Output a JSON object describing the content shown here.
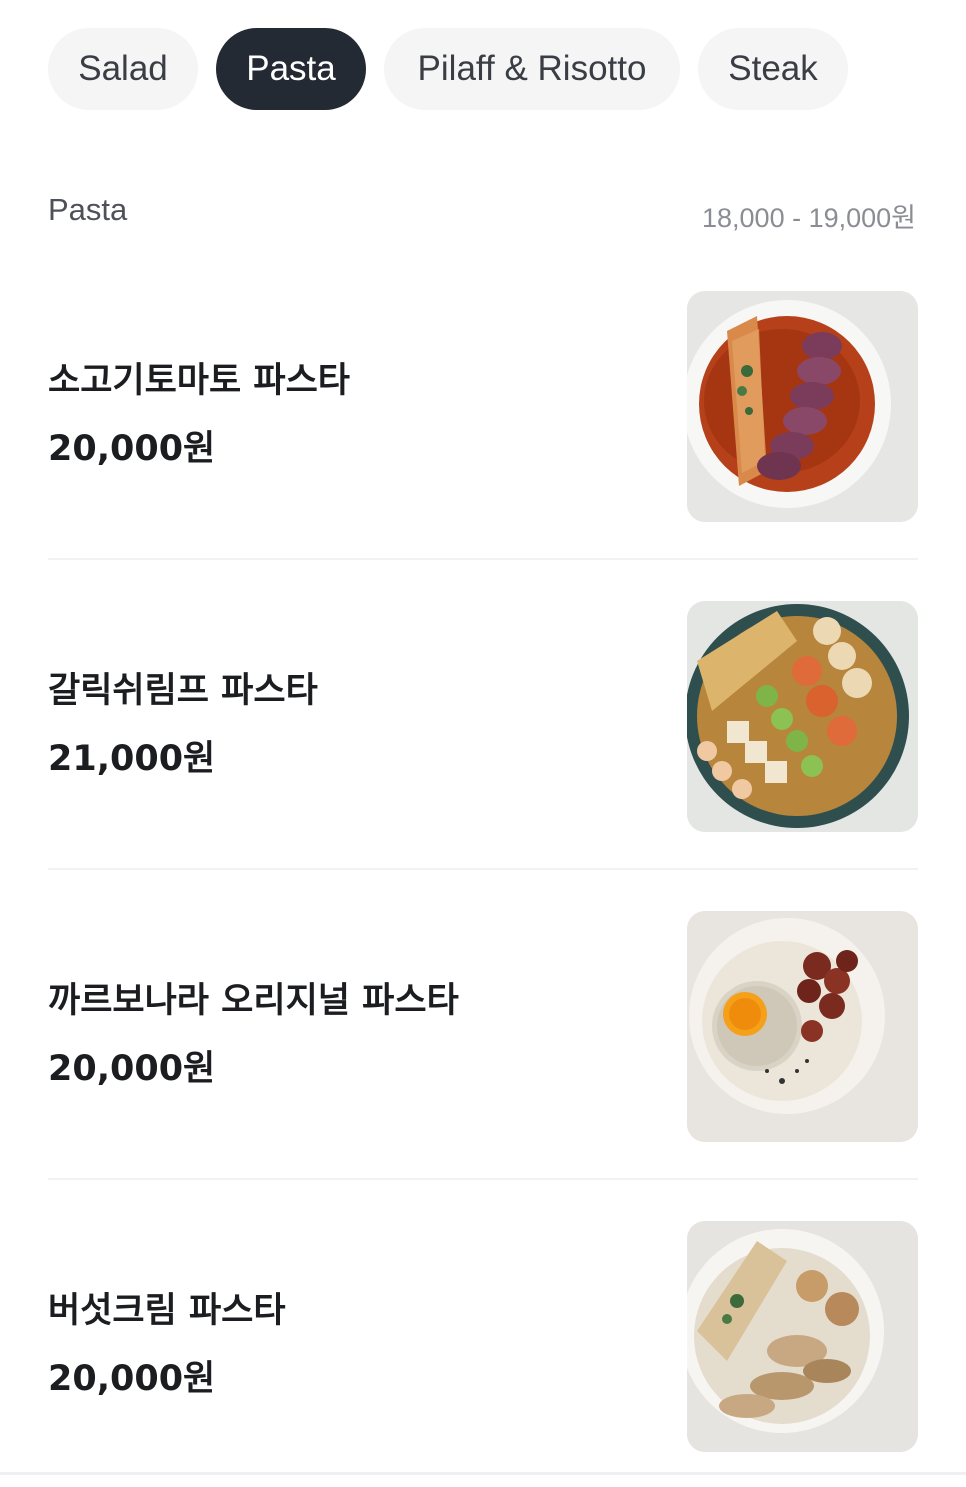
{
  "tabs": [
    {
      "label": "Salad",
      "active": false
    },
    {
      "label": "Pasta",
      "active": true
    },
    {
      "label": "Pilaff & Risotto",
      "active": false
    },
    {
      "label": "Steak",
      "active": false
    }
  ],
  "section": {
    "title": "Pasta",
    "price_range": "18,000 - 19,000원"
  },
  "items": [
    {
      "name": "소고기토마토 파스타",
      "price": "20,000원",
      "image": "beef-tomato-pasta-photo"
    },
    {
      "name": "갈릭쉬림프 파스타",
      "price": "21,000원",
      "image": "garlic-shrimp-pasta-photo"
    },
    {
      "name": "까르보나라 오리지널 파스타",
      "price": "20,000원",
      "image": "carbonara-pasta-photo"
    },
    {
      "name": "버섯크림 파스타",
      "price": "20,000원",
      "image": "mushroom-cream-pasta-photo"
    }
  ],
  "colors": {
    "active_tab": "#232a33",
    "inactive_tab": "#f5f5f6",
    "text_primary": "#1b1d21",
    "text_muted": "#8a8d93"
  }
}
